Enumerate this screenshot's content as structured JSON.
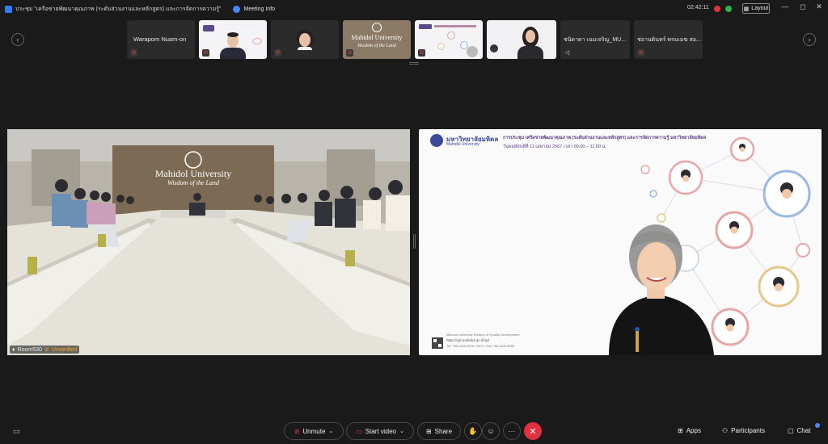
{
  "window": {
    "title": "ประชุม \"เครือข่ายพัฒนาคุณภาพ (ระดับส่วนงานและหลักสูตร) และการจัดการความรู้\"",
    "meeting_info": "Meeting Info",
    "timer": "02:42:11",
    "layout_label": "Layout",
    "controls": {
      "minimize": "—",
      "maximize": "◻",
      "close": "✕"
    }
  },
  "strip": {
    "prev_icon": "‹",
    "next_icon": "›",
    "tiles": [
      {
        "name": "Warapom Nuam-on"
      },
      {
        "name": ""
      },
      {
        "name": ""
      },
      {
        "name": "",
        "logo": "Mahidol University",
        "tagline": "Wisdom of the Land"
      },
      {
        "name": ""
      },
      {
        "name": ""
      },
      {
        "name": "ชนิดาดา เฉมเจริญ_MU..."
      },
      {
        "name": "ช่อานดินทร์ พรมเมฆ สอ..."
      }
    ]
  },
  "stage": {
    "left": {
      "room_name": "Room530",
      "room_status": "Unverified",
      "wall_logo": "Mahidol University",
      "wall_tagline": "Wisdom of the Land"
    },
    "right": {
      "slide_org_th": "มหาวิทยาลัยมหิดล",
      "slide_org_sub": "Mahidol University",
      "slide_title": "การประชุม เครือข่ายพัฒนาคุณภาพ (ระดับส่วนงานและหลักสูตร) และการจัดการความรู้ มหาวิทยาลัยมหิดล",
      "slide_date": "วันพฤหัสบดีที่ 11 เมษายน 2567 เวลา 09.00 – 11.00 น.",
      "slide_footer_1": "Mahidol University Division of Quality Development",
      "slide_footer_2": "https://qd.mahidol.ac.th/qd",
      "slide_footer_3": "Tel. +66 2849 6070 / 6072 | Fax +66 2849 6080"
    }
  },
  "toolbar": {
    "unmute": "Unmute",
    "start_video": "Start video",
    "share": "Share",
    "apps": "Apps",
    "participants": "Participants",
    "chat": "Chat",
    "more": "···",
    "leave": "✕"
  },
  "colors": {
    "accent": "#3d8bfd",
    "leave": "#e0303d",
    "muted": "#e2433a",
    "unverified": "#f6a623"
  }
}
